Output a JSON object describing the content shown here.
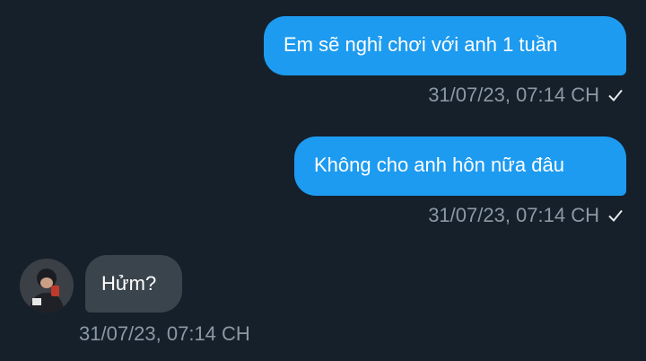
{
  "messages": [
    {
      "direction": "outgoing",
      "text": "Em sẽ nghỉ chơi với anh 1 tuần",
      "timestamp": "31/07/23, 07:14 CH",
      "status_icon": "check-icon"
    },
    {
      "direction": "outgoing",
      "text": "Không cho anh hôn nữa đâu",
      "timestamp": "31/07/23, 07:14 CH",
      "status_icon": "check-icon"
    },
    {
      "direction": "incoming",
      "text": "Hửm?",
      "timestamp": "31/07/23, 07:14 CH",
      "avatar_icon": "user-avatar"
    }
  ],
  "colors": {
    "background": "#15202b",
    "outgoing_bubble": "#1d9bf0",
    "incoming_bubble": "#3a444c",
    "meta_text": "#8b98a5"
  }
}
